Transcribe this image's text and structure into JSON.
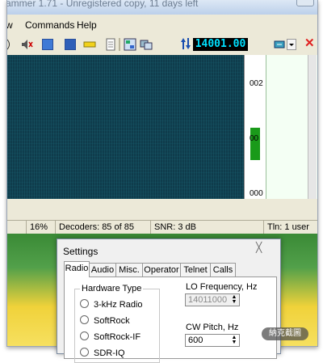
{
  "window": {
    "title": "ammer 1.71 - Unregistered copy, 11 days left"
  },
  "menu": {
    "items": [
      "w",
      "Commands",
      "Help"
    ]
  },
  "toolbar": {
    "frequency": "14001.00"
  },
  "waterfall": {
    "scale_labels": [
      "002",
      "00",
      "000"
    ]
  },
  "statusbar": {
    "cpu": "16%",
    "decoders": "Decoders: 85 of 85",
    "snr": "SNR: 3 dB",
    "users": "Tln: 1 user"
  },
  "settings": {
    "title": "Settings",
    "close_glyph": "╳",
    "tabs": [
      "Radio",
      "Audio",
      "Misc.",
      "Operator",
      "Telnet",
      "Calls"
    ],
    "active_tab": "Radio",
    "hardware_type": {
      "label": "Hardware Type",
      "options": [
        "3-kHz Radio",
        "SoftRock",
        "SoftRock-IF",
        "SDR-IQ"
      ]
    },
    "lo_frequency": {
      "label": "LO Frequency, Hz",
      "value": "14011000"
    },
    "cw_pitch": {
      "label": "CW Pitch, Hz",
      "value": "600"
    }
  },
  "overlay": {
    "screenshot_button": "納克截圖"
  },
  "colors": {
    "waterfall_bg": "#0f3c4c",
    "freq_text": "#00e0ff",
    "marker": "#1a9a1a",
    "close_red": "#e02020"
  }
}
